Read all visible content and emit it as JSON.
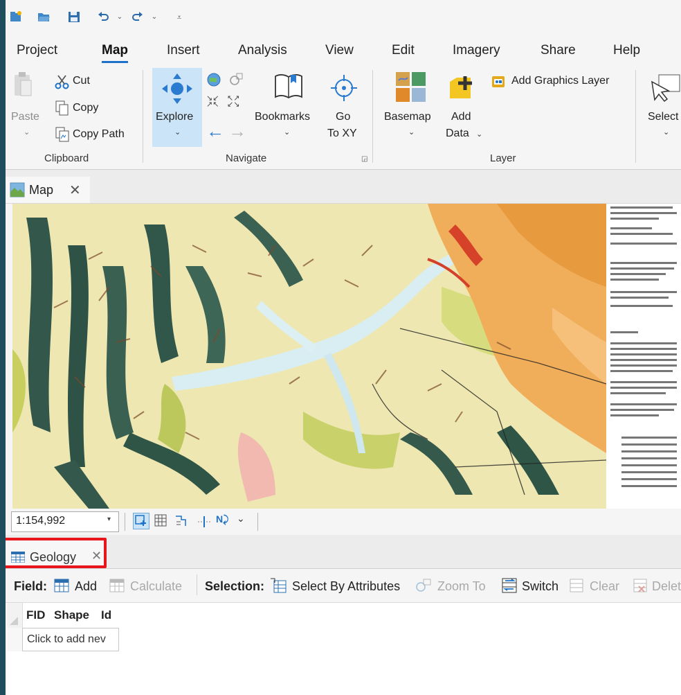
{
  "menu": [
    "Project",
    "Map",
    "Insert",
    "Analysis",
    "View",
    "Edit",
    "Imagery",
    "Share",
    "Help"
  ],
  "clipboard": {
    "paste": "Paste",
    "cut": "Cut",
    "copy": "Copy",
    "copy_path": "Copy Path",
    "group": "Clipboard"
  },
  "navigate": {
    "explore": "Explore",
    "bookmarks": "Bookmarks",
    "go": "Go",
    "to_xy": "To XY",
    "group": "Navigate"
  },
  "layer": {
    "basemap": "Basemap",
    "add": "Add",
    "data": "Data",
    "add_graphics": "Add Graphics Layer",
    "group": "Layer"
  },
  "selection_group": {
    "select": "Select"
  },
  "map_tab": {
    "label": "Map"
  },
  "scale": {
    "value": "1:154,992"
  },
  "table_tab": {
    "label": "Geology"
  },
  "table_toolbar": {
    "field_label": "Field:",
    "add": "Add",
    "calculate": "Calculate",
    "selection_label": "Selection:",
    "select_by_attributes": "Select By Attributes",
    "zoom_to": "Zoom To",
    "switch": "Switch",
    "clear": "Clear",
    "delete": "Delet"
  },
  "table": {
    "columns": [
      "FID",
      "Shape",
      "Id"
    ],
    "new_row_text": "Click to add nev"
  },
  "colors": {
    "accent": "#1c72c9",
    "highlight": "#e8161c",
    "explore_bg": "#cce4f7"
  }
}
